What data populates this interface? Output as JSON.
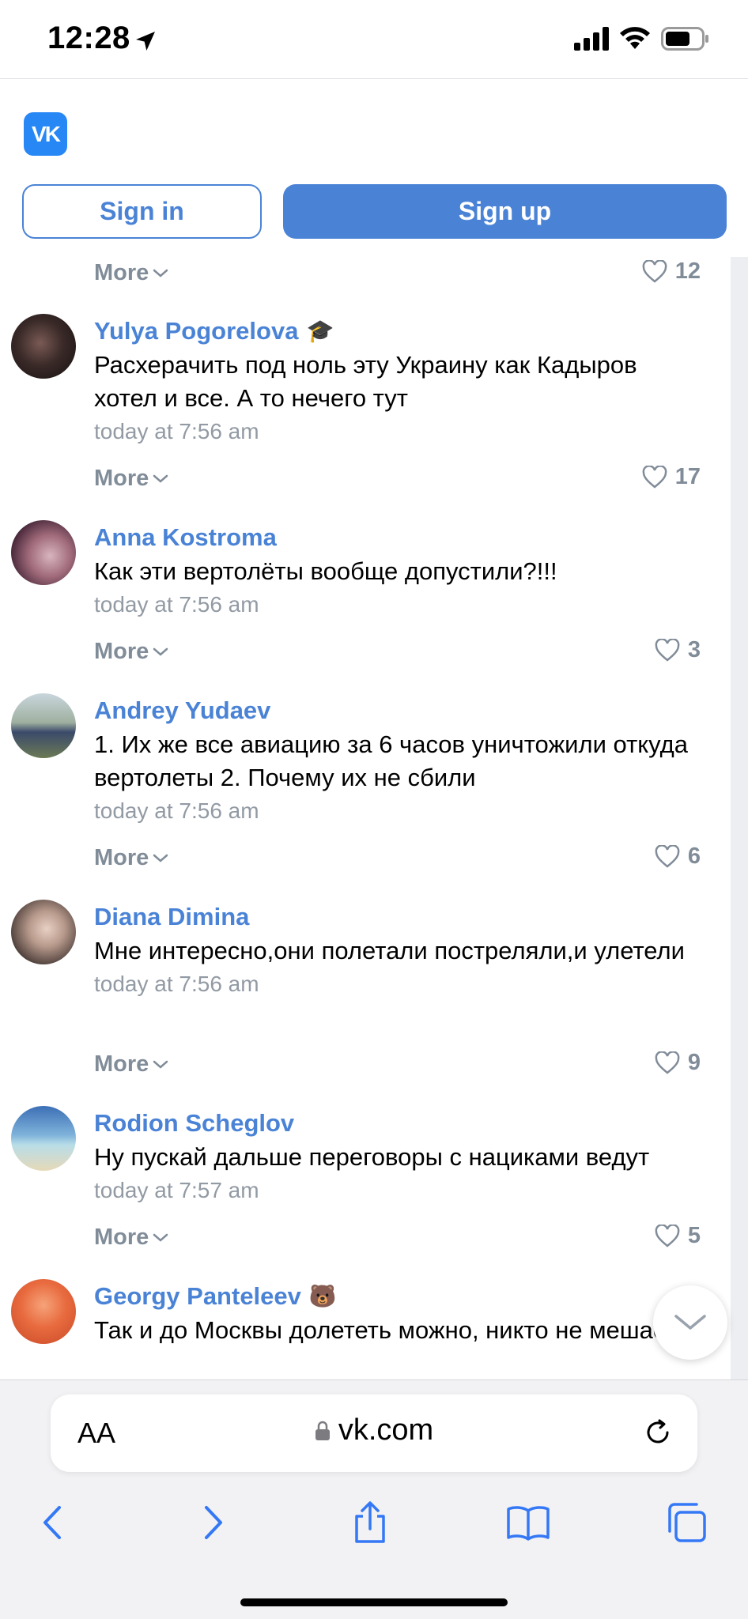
{
  "status_bar": {
    "time": "12:28"
  },
  "header": {
    "logo_text": "VK",
    "sign_in": "Sign in",
    "sign_up": "Sign up"
  },
  "top_more": {
    "more": "More",
    "likes": "12"
  },
  "comments": [
    {
      "name": "Yulya Pogorelova",
      "badge": "🎓",
      "text": "Расхерачить под ноль эту Украину как Кадыров хотел и все. А то нечего тут",
      "time": "today at 7:56 am",
      "more": "More",
      "likes": "17"
    },
    {
      "name": "Anna Kostroma",
      "text": "Как эти вертолёты вообще допустили?!!!",
      "time": "today at 7:56 am",
      "more": "More",
      "likes": "3"
    },
    {
      "name": "Andrey Yudaev",
      "text": "1. Их же все авиацию за 6 часов уничтожили откуда вертолеты 2. Почему их не сбили",
      "time": "today at 7:56 am",
      "more": "More",
      "likes": "6"
    },
    {
      "name": "Diana Dimina",
      "text": "Мне интересно,они полетали постреляли,и улетели",
      "time": "today at 7:56 am",
      "more": "More",
      "likes": "9"
    },
    {
      "name": "Rodion Scheglov",
      "text": "Ну пускай дальше переговоры с нациками ведут",
      "time": "today at 7:57 am",
      "more": "More",
      "likes": "5"
    },
    {
      "name": "Georgy Panteleev",
      "badge": "🐻",
      "text": "Так и до Москвы долететь можно, никто не мешает"
    }
  ],
  "browser": {
    "aa_label": "AA",
    "url": "vk.com"
  }
}
